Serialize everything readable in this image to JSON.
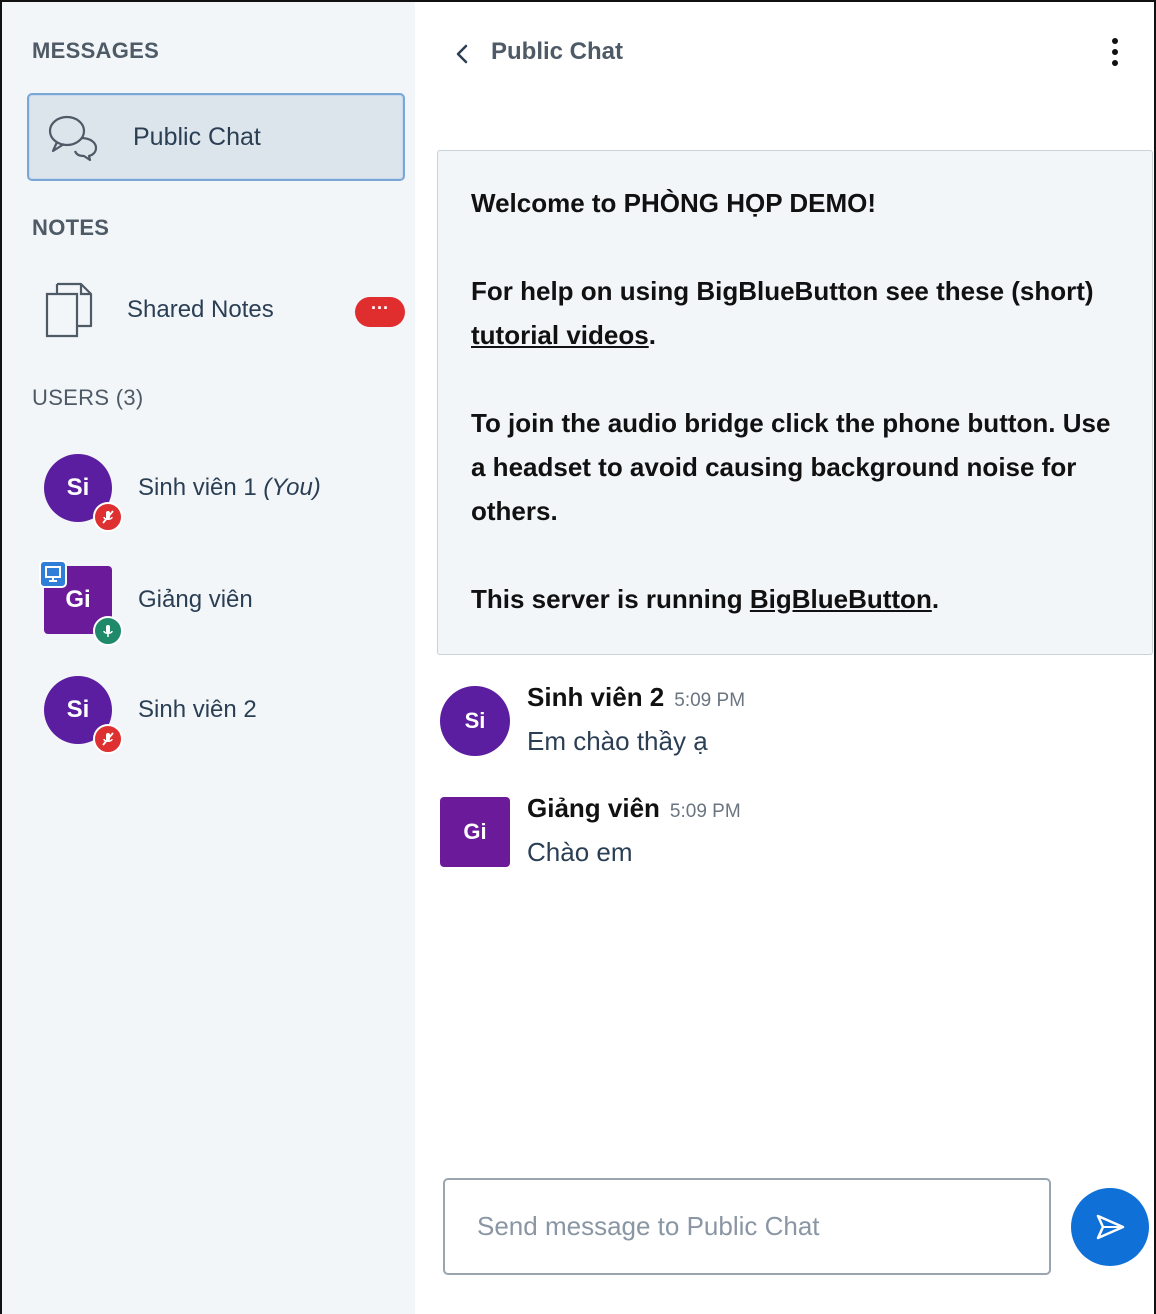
{
  "sidebar": {
    "messages_title": "MESSAGES",
    "public_chat_label": "Public Chat",
    "notes_title": "NOTES",
    "shared_notes_label": "Shared Notes",
    "shared_notes_badge": "···",
    "users_title": "USERS (3)",
    "users": [
      {
        "initials": "Si",
        "name": "Sinh viên 1",
        "suffix": "(You)",
        "status": "muted",
        "avatar_shape": "round"
      },
      {
        "initials": "Gi",
        "name": "Giảng viên",
        "suffix": "",
        "status": "talking",
        "avatar_shape": "square",
        "presenter": true
      },
      {
        "initials": "Si",
        "name": "Sinh viên 2",
        "suffix": "",
        "status": "muted",
        "avatar_shape": "round"
      }
    ]
  },
  "chat": {
    "title": "Public Chat",
    "welcome": {
      "line1_prefix": "Welcome to ",
      "line1_room": "PHÒNG HỌP DEMO",
      "line1_suffix": "!",
      "line2_prefix": "For help on using BigBlueButton see these (short) ",
      "line2_link": "tutorial videos",
      "line2_suffix": ".",
      "line3": "To join the audio bridge click the phone button. Use a headset to avoid causing background noise for others.",
      "line4_prefix": "This server is running ",
      "line4_link": "BigBlueButton",
      "line4_suffix": "."
    },
    "messages": [
      {
        "initials": "Si",
        "sender": "Sinh viên 2",
        "time": "5:09 PM",
        "text": "Em chào thầy ạ",
        "avatar_shape": "round"
      },
      {
        "initials": "Gi",
        "sender": "Giảng viên",
        "time": "5:09 PM",
        "text": "Chào em",
        "avatar_shape": "square"
      }
    ],
    "input_placeholder": "Send message to Public Chat"
  },
  "colors": {
    "accent": "#0f70d7",
    "avatar_purple": "#5c1ea0",
    "muted_red": "#de3030",
    "talking_green": "#1f8a6a",
    "badge_red": "#e02d2d"
  }
}
